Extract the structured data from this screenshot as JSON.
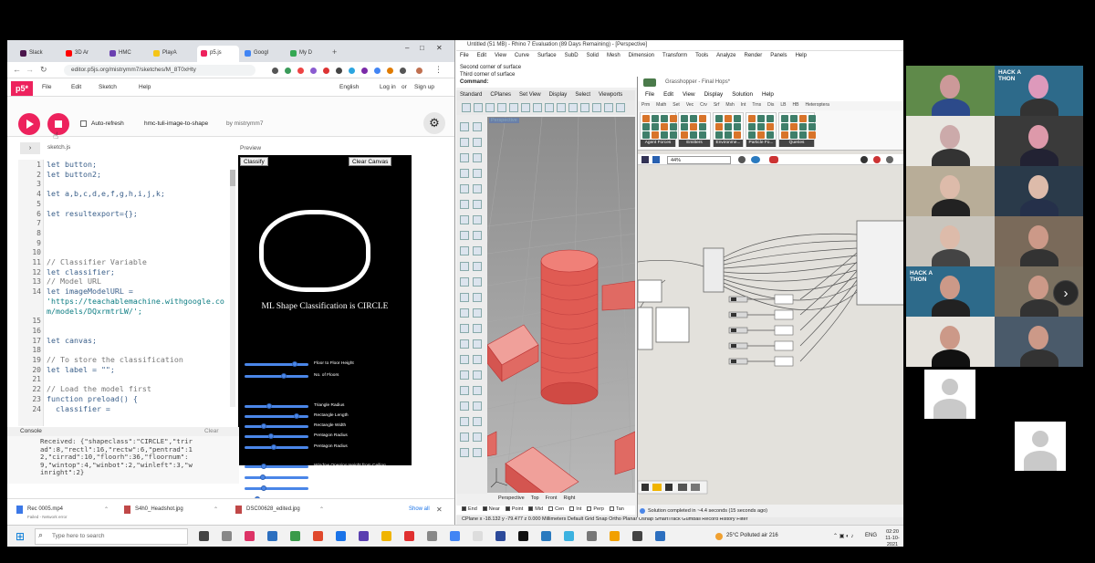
{
  "browser": {
    "tabs": [
      {
        "label": "Slack",
        "color": "#4a154b"
      },
      {
        "label": "3D Ar",
        "color": "#ff0000"
      },
      {
        "label": "HMC",
        "color": "#6a3fb0"
      },
      {
        "label": "PlayA",
        "color": "#f5c518"
      },
      {
        "label": "p5.js",
        "color": "#ed225d"
      },
      {
        "label": "Googl",
        "color": "#4285f4"
      },
      {
        "label": "My D",
        "color": "#34a853"
      }
    ],
    "url": "editor.p5js.org/mistrymm7/sketches/M_8T0xHty"
  },
  "p5": {
    "logo": "p5*",
    "menu": [
      "File",
      "Edit",
      "Sketch",
      "Help"
    ],
    "language": "English",
    "login": "Log in",
    "or": "or",
    "signup": "Sign up",
    "autorefresh": "Auto-refresh",
    "sketch_name": "hmc-tuli-image-to-shape",
    "author": "by mistrymm7",
    "filename": "sketch.js",
    "preview_label": "Preview",
    "console_label": "Console",
    "clear_label": "Clear"
  },
  "code": {
    "line_numbers": [
      "1",
      "2",
      "3",
      "4",
      "5",
      "6",
      "7",
      "8",
      "9",
      "10",
      "11",
      "12",
      "13",
      "14",
      "",
      "",
      "15",
      "16",
      "17",
      "18",
      "19",
      "20",
      "21",
      "22",
      "23",
      "24"
    ],
    "lines": [
      {
        "t": "let button;",
        "k": "code"
      },
      {
        "t": "let button2;",
        "k": "code"
      },
      {
        "t": "",
        "k": "code"
      },
      {
        "t": "let a,b,c,d,e,f,g,h,i,j,k;",
        "k": "code"
      },
      {
        "t": "",
        "k": "code"
      },
      {
        "t": "let resultexport={};",
        "k": "code"
      },
      {
        "t": "",
        "k": "code"
      },
      {
        "t": "",
        "k": "code"
      },
      {
        "t": "",
        "k": "code"
      },
      {
        "t": "",
        "k": "code"
      },
      {
        "t": "// Classifier Variable",
        "k": "comment"
      },
      {
        "t": "let classifier;",
        "k": "code"
      },
      {
        "t": "// Model URL",
        "k": "comment"
      },
      {
        "t": "let imageModelURL =",
        "k": "code"
      },
      {
        "t": "'https://teachablemachine.withgoogle.co",
        "k": "str"
      },
      {
        "t": "m/models/DQxrmtrLW/';",
        "k": "str"
      },
      {
        "t": "",
        "k": "code"
      },
      {
        "t": "",
        "k": "code"
      },
      {
        "t": "let canvas;",
        "k": "code"
      },
      {
        "t": "",
        "k": "code"
      },
      {
        "t": "// To store the classification",
        "k": "comment"
      },
      {
        "t": "let label = \"\";",
        "k": "code"
      },
      {
        "t": "",
        "k": "code"
      },
      {
        "t": "// Load the model first",
        "k": "comment"
      },
      {
        "t": "function preload() {",
        "k": "code"
      },
      {
        "t": "  classifier =",
        "k": "code"
      }
    ]
  },
  "preview": {
    "classify_button": "Classify",
    "clear_button": "Clear Canvas",
    "result_title": "ML Shape Classification is CIRCLE",
    "sliders": [
      {
        "label": "Floor to Floor Height",
        "value": 0.78
      },
      {
        "label": "No. of Floors",
        "value": 0.62
      },
      {
        "label": "Triangle Radius",
        "value": 0.38
      },
      {
        "label": "Rectangle Length",
        "value": 0.82
      },
      {
        "label": "Rectangle Width",
        "value": 0.3
      },
      {
        "label": "Pentagon Radius",
        "value": 0.42
      },
      {
        "label": "Pentagon Radius",
        "value": 0.45
      },
      {
        "label": "Window Opening Height from Ceiling",
        "value": 0.3
      },
      {
        "label": "Window Opening Height from Floor",
        "value": 0.28
      },
      {
        "label": "Window Width from Left Edge",
        "value": 0.3
      },
      {
        "label": "Window Width from Right Edge",
        "value": 0.2
      }
    ]
  },
  "console": {
    "output": "Received: {\"shapeclass\":\"CIRCLE\",\"trir\nad\":8,\"rectl\":16,\"rectw\":6,\"pentrad\":1\n2,\"cirrad\":10,\"floorh\":36,\"floornum\":\n9,\"wintop\":4,\"winbot\":2,\"winleft\":3,\"w\ninright\":2}"
  },
  "downloads": {
    "items": [
      "Rec 0005.mp4",
      "S4h0_Headshot.jpg",
      "DSC00628_edited.jpg"
    ],
    "subtext": "Failed - Network error",
    "show_all": "Show all"
  },
  "rhino": {
    "title": "Untitled (51 MB) - Rhino 7 Evaluation (89 Days Remaining) - [Perspective]",
    "menu": [
      "File",
      "Edit",
      "View",
      "Curve",
      "Surface",
      "SubD",
      "Solid",
      "Mesh",
      "Dimension",
      "Transform",
      "Tools",
      "Analyze",
      "Render",
      "Panels",
      "Help"
    ],
    "command_history": [
      "Second corner of surface",
      "Third corner of surface",
      "Command:"
    ],
    "tabs": [
      "Standard",
      "CPlanes",
      "Set View",
      "Display",
      "Select",
      "Viewports"
    ],
    "viewport_label": "Perspective",
    "view_tabs": [
      "Perspective",
      "Top",
      "Front",
      "Right"
    ],
    "osnaps": [
      "End",
      "Near",
      "Point",
      "Mid",
      "Cen",
      "Int",
      "Perp",
      "Tan"
    ],
    "status": "CPlane   x -18.132   y -79.477   z 0.000      Millimeters    Default          Grid Snap  Ortho  Planar  Osnap  SmartTrack  Gumball  Record History  Filter"
  },
  "grasshopper": {
    "title": "Grasshopper - Final Hops*",
    "menu": [
      "File",
      "Edit",
      "View",
      "Display",
      "Solution",
      "Help"
    ],
    "tabs": [
      "Prm",
      "Math",
      "Set",
      "Vec",
      "Crv",
      "Srf",
      "Msh",
      "Int",
      "Trns",
      "Dis",
      "LB",
      "HB",
      "Heteroptera"
    ],
    "groups": [
      "Agent Forces",
      "Emitters",
      "Environme...",
      "Particle Fo...",
      "Queries"
    ],
    "zoom": "44%",
    "status": "Solution completed in ~4.4 seconds (15 seconds ago)"
  },
  "taskbar": {
    "search_placeholder": "Type here to search",
    "weather": "25°C  Polluted air 216",
    "lang": "ENG",
    "time": "02:20",
    "date": "11-10-2021"
  },
  "participants": {
    "hack_text": "HACK A THON"
  }
}
